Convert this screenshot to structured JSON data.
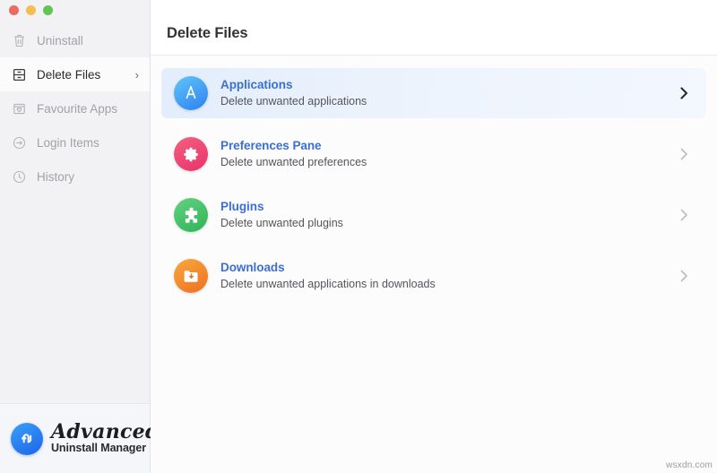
{
  "window": {
    "traffic_lights": [
      {
        "name": "close",
        "color": "#ec6a5f"
      },
      {
        "name": "minimize",
        "color": "#f4bd50"
      },
      {
        "name": "zoom",
        "color": "#61c454"
      }
    ]
  },
  "sidebar": {
    "items": [
      {
        "label": "Uninstall",
        "icon": "trash-icon",
        "active": false
      },
      {
        "label": "Delete Files",
        "icon": "file-cabinet-icon",
        "active": true,
        "chevron": "›"
      },
      {
        "label": "Favourite Apps",
        "icon": "heart-box-icon",
        "active": false
      },
      {
        "label": "Login Items",
        "icon": "login-arrow-icon",
        "active": false
      },
      {
        "label": "History",
        "icon": "clock-icon",
        "active": false
      }
    ],
    "brand": {
      "name": "Advanced",
      "subtitle": "Uninstall Manager",
      "mark_icon": "uninstall-loop-icon",
      "accent": "#1e63e9"
    }
  },
  "main": {
    "title": "Delete Files",
    "rows": [
      {
        "title": "Applications",
        "subtitle": "Delete unwanted applications",
        "icon": "app-store-icon",
        "icon_class": "ic-applications",
        "accent": "#2f7ff0",
        "selected": true
      },
      {
        "title": "Preferences Pane",
        "subtitle": "Delete unwanted preferences",
        "icon": "gear-icon",
        "icon_class": "ic-preferences",
        "accent": "#e8336d",
        "selected": false
      },
      {
        "title": "Plugins",
        "subtitle": "Delete unwanted plugins",
        "icon": "puzzle-piece-icon",
        "icon_class": "ic-plugins",
        "accent": "#2fb457",
        "selected": false
      },
      {
        "title": "Downloads",
        "subtitle": "Delete unwanted applications in downloads",
        "icon": "folder-download-icon",
        "icon_class": "ic-downloads",
        "accent": "#ef6f22",
        "selected": false
      }
    ]
  },
  "watermark": {
    "text": "wsxdn.com"
  }
}
